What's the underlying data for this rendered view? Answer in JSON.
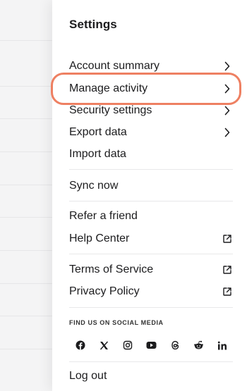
{
  "settings": {
    "title": "Settings",
    "items": {
      "account_summary": "Account summary",
      "manage_activity": "Manage activity",
      "security_settings": "Security settings",
      "export_data": "Export data",
      "import_data": "Import data",
      "sync_now": "Sync now",
      "refer_a_friend": "Refer a friend",
      "help_center": "Help Center",
      "terms_of_service": "Terms of Service",
      "privacy_policy": "Privacy Policy",
      "log_out": "Log out"
    },
    "icons": {
      "chevron": "chevron-right-icon",
      "external": "external-link-icon"
    },
    "social": {
      "title": "FIND US ON SOCIAL MEDIA",
      "networks": [
        "facebook",
        "x",
        "instagram",
        "youtube",
        "threads",
        "reddit",
        "linkedin"
      ]
    },
    "highlight_color": "#ee8062"
  }
}
